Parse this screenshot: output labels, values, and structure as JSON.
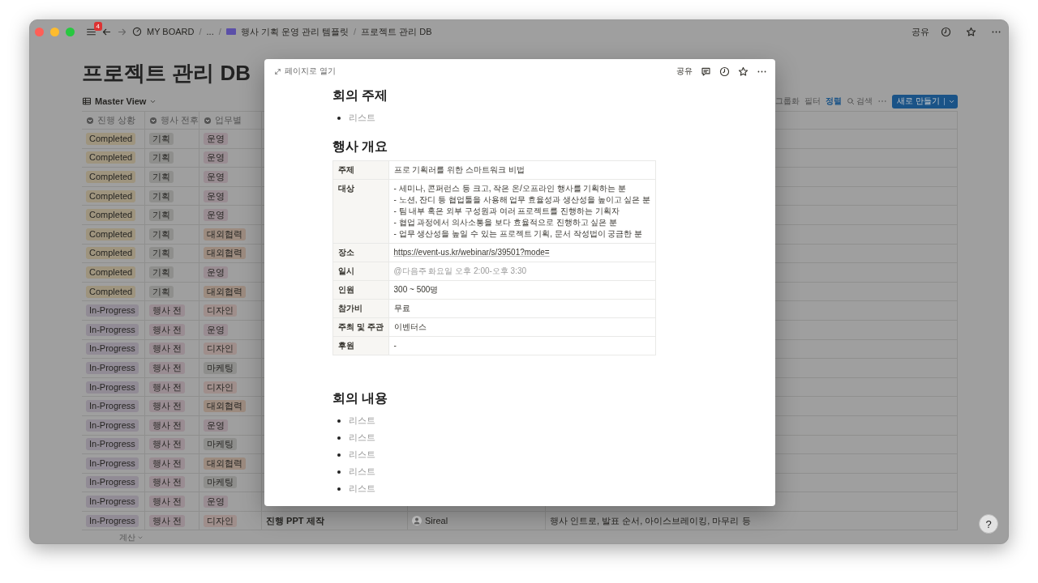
{
  "window": {
    "badge": "4",
    "breadcrumb": [
      {
        "kind": "board",
        "text": "MY BOARD"
      },
      {
        "kind": "ellipsis",
        "separator": "/",
        "text": "..."
      },
      {
        "kind": "template",
        "separator": "/",
        "text": "행사 기획 운영 관리 템플릿"
      },
      {
        "kind": "current",
        "separator": "/",
        "text": "프로젝트 관리 DB"
      }
    ],
    "share": "공유",
    "help": "?"
  },
  "database": {
    "title": "프로젝트 관리 DB",
    "view": "Master View",
    "toolbar": [
      {
        "kind": "text",
        "label": "그룹화",
        "active": false
      },
      {
        "kind": "text",
        "label": "필터",
        "active": false
      },
      {
        "kind": "text",
        "label": "정렬",
        "active": true
      },
      {
        "kind": "search",
        "label": "검색",
        "active": false
      }
    ],
    "new_button": "새로 만들기",
    "columns": [
      {
        "label": "진행 상황"
      },
      {
        "label": "행사 전후"
      },
      {
        "label": "업무별"
      }
    ],
    "rows": [
      {
        "status": {
          "text": "Completed",
          "color": "#9e947e"
        },
        "phase": {
          "text": "기획",
          "color": "#8e8e8c"
        },
        "dept": {
          "text": "운영",
          "color": "#998c92"
        }
      },
      {
        "status": {
          "text": "Completed",
          "color": "#9e947e"
        },
        "phase": {
          "text": "기획",
          "color": "#8e8e8c"
        },
        "dept": {
          "text": "운영",
          "color": "#998c92"
        }
      },
      {
        "status": {
          "text": "Completed",
          "color": "#9e947e"
        },
        "phase": {
          "text": "기획",
          "color": "#8e8e8c"
        },
        "dept": {
          "text": "운영",
          "color": "#998c92"
        }
      },
      {
        "status": {
          "text": "Completed",
          "color": "#9e947e"
        },
        "phase": {
          "text": "기획",
          "color": "#8e8e8c"
        },
        "dept": {
          "text": "운영",
          "color": "#998c92"
        }
      },
      {
        "status": {
          "text": "Completed",
          "color": "#9e947e"
        },
        "phase": {
          "text": "기획",
          "color": "#8e8e8c"
        },
        "dept": {
          "text": "운영",
          "color": "#998c92"
        }
      },
      {
        "status": {
          "text": "Completed",
          "color": "#9e947e"
        },
        "phase": {
          "text": "기획",
          "color": "#8e8e8c"
        },
        "dept": {
          "text": "대외협력",
          "color": "#9c8b7f"
        }
      },
      {
        "status": {
          "text": "Completed",
          "color": "#9e947e"
        },
        "phase": {
          "text": "기획",
          "color": "#8e8e8c"
        },
        "dept": {
          "text": "대외협력",
          "color": "#9c8b7f"
        }
      },
      {
        "status": {
          "text": "Completed",
          "color": "#9e947e"
        },
        "phase": {
          "text": "기획",
          "color": "#8e8e8c"
        },
        "dept": {
          "text": "운영",
          "color": "#998c92"
        }
      },
      {
        "status": {
          "text": "Completed",
          "color": "#9e947e"
        },
        "phase": {
          "text": "기획",
          "color": "#8e8e8c"
        },
        "dept": {
          "text": "대외협력",
          "color": "#9c8b7f"
        }
      },
      {
        "status": {
          "text": "In-Progress",
          "color": "#918b95"
        },
        "phase": {
          "text": "행사 전",
          "color": "#998c92"
        },
        "dept": {
          "text": "디자인",
          "color": "#9f8e8b"
        }
      },
      {
        "status": {
          "text": "In-Progress",
          "color": "#918b95"
        },
        "phase": {
          "text": "행사 전",
          "color": "#998c92"
        },
        "dept": {
          "text": "운영",
          "color": "#998c92"
        }
      },
      {
        "status": {
          "text": "In-Progress",
          "color": "#918b95"
        },
        "phase": {
          "text": "행사 전",
          "color": "#998c92"
        },
        "dept": {
          "text": "디자인",
          "color": "#9f8e8b"
        }
      },
      {
        "status": {
          "text": "In-Progress",
          "color": "#918b95"
        },
        "phase": {
          "text": "행사 전",
          "color": "#998c92"
        },
        "dept": {
          "text": "마케팅",
          "color": "#8e8e8c"
        }
      },
      {
        "status": {
          "text": "In-Progress",
          "color": "#918b95"
        },
        "phase": {
          "text": "행사 전",
          "color": "#998c92"
        },
        "dept": {
          "text": "디자인",
          "color": "#9f8e8b"
        }
      },
      {
        "status": {
          "text": "In-Progress",
          "color": "#918b95"
        },
        "phase": {
          "text": "행사 전",
          "color": "#998c92"
        },
        "dept": {
          "text": "대외협력",
          "color": "#9c8b7f"
        }
      },
      {
        "status": {
          "text": "In-Progress",
          "color": "#918b95"
        },
        "phase": {
          "text": "행사 전",
          "color": "#998c92"
        },
        "dept": {
          "text": "운영",
          "color": "#998c92"
        }
      },
      {
        "status": {
          "text": "In-Progress",
          "color": "#918b95"
        },
        "phase": {
          "text": "행사 전",
          "color": "#998c92"
        },
        "dept": {
          "text": "마케팅",
          "color": "#8e8e8c"
        }
      },
      {
        "status": {
          "text": "In-Progress",
          "color": "#918b95"
        },
        "phase": {
          "text": "행사 전",
          "color": "#998c92"
        },
        "dept": {
          "text": "대외협력",
          "color": "#9c8b7f"
        }
      },
      {
        "status": {
          "text": "In-Progress",
          "color": "#918b95"
        },
        "phase": {
          "text": "행사 전",
          "color": "#998c92"
        },
        "dept": {
          "text": "마케팅",
          "color": "#8e8e8c"
        }
      },
      {
        "status": {
          "text": "In-Progress",
          "color": "#918b95"
        },
        "phase": {
          "text": "행사 전",
          "color": "#998c92"
        },
        "dept": {
          "text": "운영",
          "color": "#998c92"
        }
      },
      {
        "status": {
          "text": "In-Progress",
          "color": "#918b95"
        },
        "phase": {
          "text": "행사 전",
          "color": "#998c92"
        },
        "dept": {
          "text": "디자인",
          "color": "#9f8e8b"
        },
        "task": "진행 PPT 제작",
        "owner": "Sireal",
        "note": "행사 인트로, 발표 순서, 아이스브레이킹, 마무리 등"
      }
    ],
    "footer": "계산"
  },
  "modal": {
    "open_label": "페이지로 열기",
    "share": "공유",
    "blocks": [
      {
        "kind": "heading",
        "text": "회의 주제"
      },
      {
        "kind": "bullets",
        "items": [
          "리스트"
        ]
      },
      {
        "kind": "heading",
        "text": "행사 개요"
      },
      {
        "kind": "table",
        "rows": [
          {
            "kind": "text",
            "label": "주제",
            "value": "프로 기획러를 위한 스마트워크 비법"
          },
          {
            "kind": "text",
            "label": "대상",
            "value": "- 세미나, 콘퍼런스 등 크고, 작은 온/오프라인 행사를 기획하는 분\n- 노션, 잔디 등 협업툴을 사용해 업무 효율성과 생산성을 높이고 싶은 분\n- 팀 내부 혹은 외부 구성원과 여러 프로젝트를 진행하는 기획자\n- 협업 과정에서 의사소통을 보다 효율적으로 진행하고 싶은 분\n- 업무 생산성을 높일 수 있는 프로젝트 기획, 문서 작성법이 궁금한 분"
          },
          {
            "kind": "link",
            "label": "장소",
            "value": "https://event-us.kr/webinar/s/39501?mode="
          },
          {
            "kind": "mention",
            "label": "일시",
            "value": "@다음주 화요일 오후 2:00-오후 3:30"
          },
          {
            "kind": "text",
            "label": "인원",
            "value": "300 ~ 500명"
          },
          {
            "kind": "text",
            "label": "참가비",
            "value": "무료"
          },
          {
            "kind": "text",
            "label": "주최 및 주관",
            "value": "이벤터스"
          },
          {
            "kind": "text",
            "label": "후원",
            "value": "-"
          }
        ]
      },
      {
        "kind": "spacer"
      },
      {
        "kind": "heading",
        "text": "회의 내용"
      },
      {
        "kind": "bullets",
        "items": [
          "리스트",
          "리스트",
          "리스트",
          "리스트",
          "리스트"
        ]
      }
    ]
  }
}
